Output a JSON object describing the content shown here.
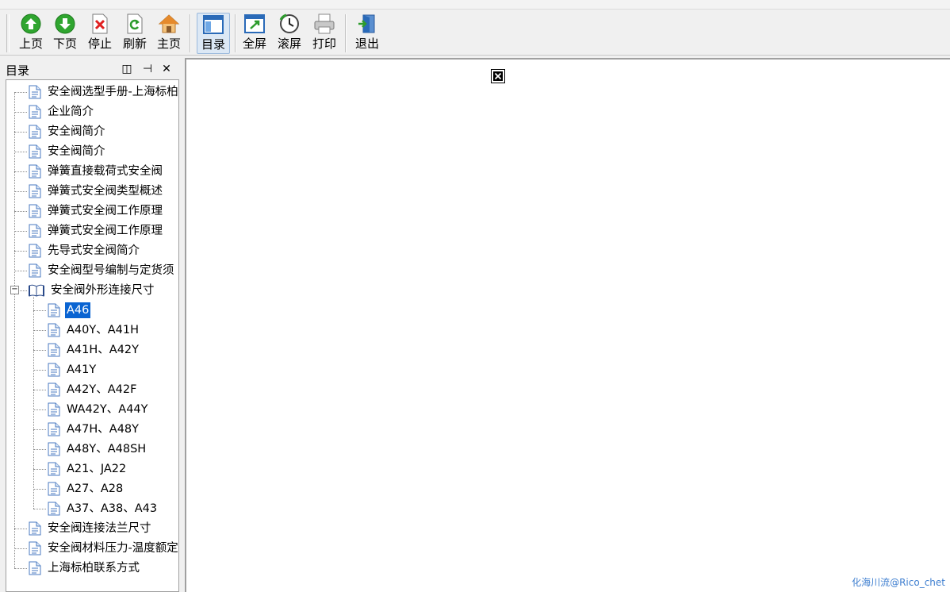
{
  "toolbar": {
    "buttons": [
      {
        "label": "上页",
        "icon": "arrow-up-icon"
      },
      {
        "label": "下页",
        "icon": "arrow-down-icon"
      },
      {
        "label": "停止",
        "icon": "stop-icon"
      },
      {
        "label": "刷新",
        "icon": "refresh-icon"
      },
      {
        "label": "主页",
        "icon": "home-icon"
      },
      {
        "label": "目录",
        "icon": "contents-icon"
      },
      {
        "label": "全屏",
        "icon": "fullscreen-icon"
      },
      {
        "label": "滚屏",
        "icon": "autoscroll-icon"
      },
      {
        "label": "打印",
        "icon": "print-icon"
      },
      {
        "label": "退出",
        "icon": "exit-icon"
      }
    ]
  },
  "pane": {
    "title": "目录",
    "buttons": {
      "float": "◫",
      "pin": "⊣",
      "close": "✕"
    }
  },
  "tree": {
    "items": [
      {
        "label": "安全阀选型手册-上海标柏",
        "level": 0
      },
      {
        "label": "企业简介",
        "level": 0
      },
      {
        "label": "安全阀简介",
        "level": 0
      },
      {
        "label": "安全阀简介",
        "level": 0
      },
      {
        "label": "弹簧直接载荷式安全阀",
        "level": 0
      },
      {
        "label": "弹簧式安全阀类型概述",
        "level": 0
      },
      {
        "label": "弹簧式安全阀工作原理",
        "level": 0
      },
      {
        "label": "弹簧式安全阀工作原理",
        "level": 0
      },
      {
        "label": "先导式安全阀简介",
        "level": 0
      },
      {
        "label": "安全阀型号编制与定货须",
        "level": 0
      },
      {
        "label": "安全阀外形连接尺寸",
        "level": 0,
        "expanded": true
      },
      {
        "label": "A46",
        "level": 1,
        "selected": true
      },
      {
        "label": "A40Y、A41H",
        "level": 1
      },
      {
        "label": "A41H、A42Y",
        "level": 1
      },
      {
        "label": "A41Y",
        "level": 1
      },
      {
        "label": "A42Y、A42F",
        "level": 1
      },
      {
        "label": "WA42Y、A44Y",
        "level": 1
      },
      {
        "label": "A47H、A48Y",
        "level": 1
      },
      {
        "label": "A48Y、A48SH",
        "level": 1
      },
      {
        "label": "A21、JA22",
        "level": 1
      },
      {
        "label": "A27、A28",
        "level": 1
      },
      {
        "label": "A37、A38、A43",
        "level": 1
      },
      {
        "label": "安全阀连接法兰尺寸",
        "level": 0
      },
      {
        "label": "安全阀材料压力-温度额定",
        "level": 0
      },
      {
        "label": "上海标柏联系方式",
        "level": 0
      }
    ]
  },
  "viewer": {
    "watermark": "化海川流@Rico_chet"
  },
  "colors": {
    "selection": "#0a64d2",
    "watermark": "#3f7fd0"
  }
}
